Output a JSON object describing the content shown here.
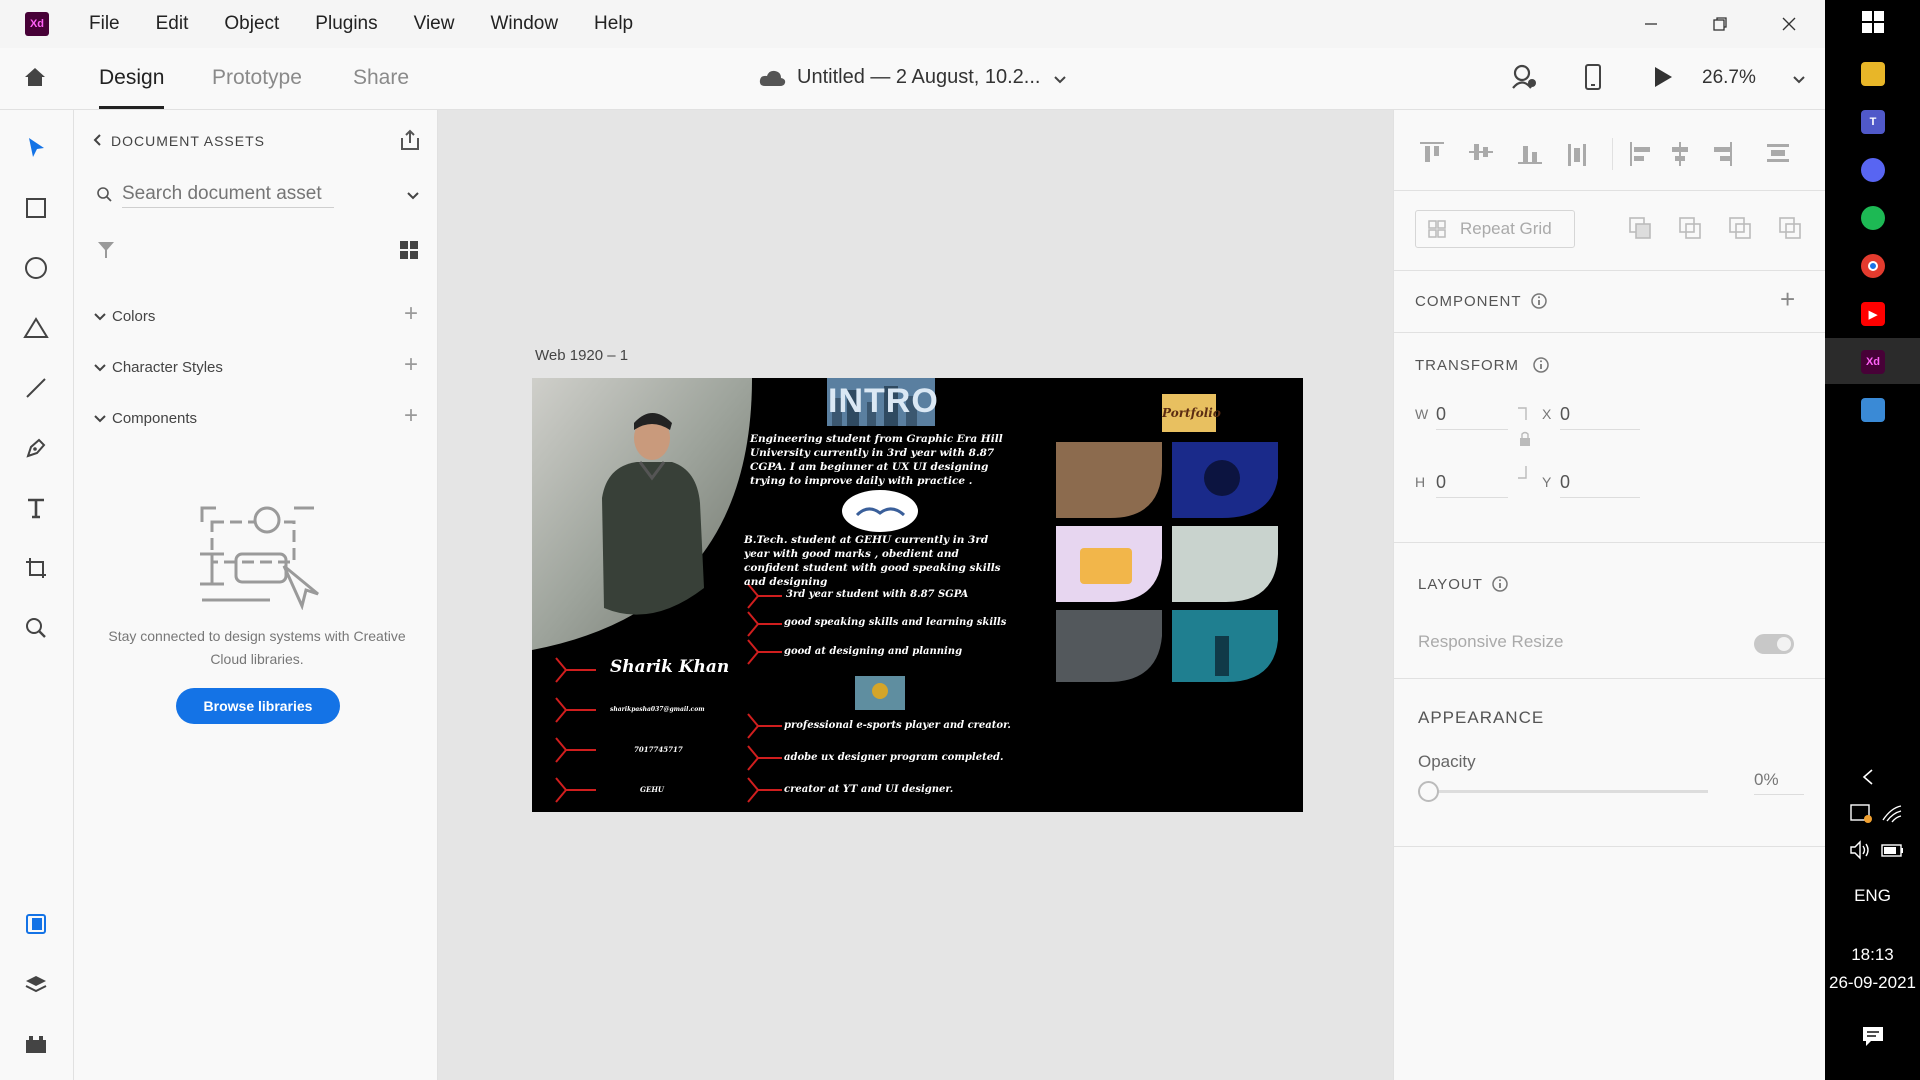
{
  "app": {
    "logo": "Xd"
  },
  "menu": [
    "File",
    "Edit",
    "Object",
    "Plugins",
    "View",
    "Window",
    "Help"
  ],
  "header": {
    "tabs": [
      "Design",
      "Prototype",
      "Share"
    ],
    "active_tab": "Design",
    "doc_title": "Untitled — 2 August, 10.2...",
    "zoom": "26.7%"
  },
  "assets": {
    "title": "DOCUMENT ASSETS",
    "search_placeholder": "Search document asset",
    "sections": [
      "Colors",
      "Character Styles",
      "Components"
    ],
    "empty_text": "Stay connected to design systems with Creative Cloud libraries.",
    "browse_label": "Browse libraries"
  },
  "canvas": {
    "artboard_label": "Web 1920 – 1",
    "artboard": {
      "intro": "INTRO",
      "portfolio": "Portfolio",
      "bio": "Engineering student from Graphic Era Hill University currently in 3rd year with 8.87 CGPA. I am beginner at UX UI designing trying to improve daily with practice .",
      "edu": "B.Tech. student at GEHU currently in 3rd year with good marks , obedient and confident student with good speaking skills and designing",
      "points_1": [
        "3rd year student with 8.87 SGPA",
        "good speaking skills and learning skills",
        "good at designing and planning"
      ],
      "points_2": [
        "professional e-sports player and creator.",
        "adobe ux designer program completed.",
        "creator at YT and UI designer."
      ],
      "name": "Sharik Khan",
      "email": "sharikpasha037@gmail.com",
      "phone": "7017745717",
      "college": "GEHU"
    }
  },
  "props": {
    "repeat_grid": "Repeat Grid",
    "component": "COMPONENT",
    "transform": "TRANSFORM",
    "w_label": "W",
    "w": "0",
    "h_label": "H",
    "h": "0",
    "x_label": "X",
    "x": "0",
    "y_label": "Y",
    "y": "0",
    "layout": "LAYOUT",
    "responsive": "Responsive Resize",
    "appearance": "APPEARANCE",
    "opacity_label": "Opacity",
    "opacity": "0%"
  },
  "taskbar": {
    "lang": "ENG",
    "time": "18:13",
    "date": "26-09-2021"
  },
  "colors": {
    "accent": "#1473e6",
    "xd_bg": "#470137",
    "xd_fg": "#ff61f6"
  }
}
